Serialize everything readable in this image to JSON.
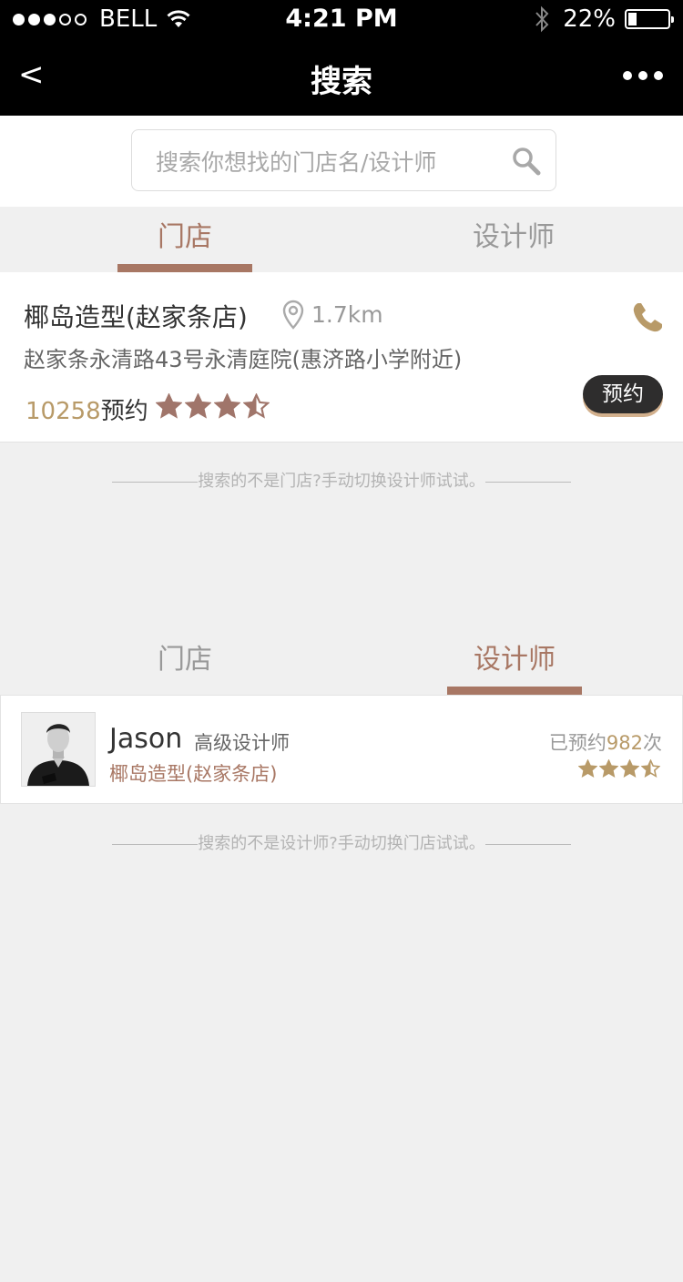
{
  "status_bar": {
    "carrier": "BELL",
    "time": "4:21 PM",
    "battery": "22%",
    "battery_level": 0.22
  },
  "nav": {
    "back": "<",
    "title": "搜索"
  },
  "search": {
    "placeholder": "搜索你想找的门店名/设计师"
  },
  "tabs_top": {
    "store": "门店",
    "designer": "设计师",
    "active": "store"
  },
  "store": {
    "name": "椰岛造型(赵家条店)",
    "distance": "1.7km",
    "address": "赵家条永清路43号永清庭院(惠济路小学附近)",
    "booking_count": "10258",
    "booking_suffix": "预约",
    "rating": 3.5,
    "reserve_label": "预约"
  },
  "hint_store": "搜索的不是门店?手动切换设计师试试。",
  "tabs_bottom": {
    "store": "门店",
    "designer": "设计师",
    "active": "designer"
  },
  "designer": {
    "name": "Jason",
    "title": "高级设计师",
    "store": "椰岛造型(赵家条店)",
    "booked_prefix": "已预约",
    "booked_count": "982",
    "booked_suffix": "次",
    "rating": 3.5
  },
  "hint_designer": "搜索的不是设计师?手动切换门店试试。",
  "colors": {
    "accent": "#a87764",
    "gold": "#b89a68",
    "star_store": "#a0756a",
    "star_designer": "#b89a68"
  }
}
